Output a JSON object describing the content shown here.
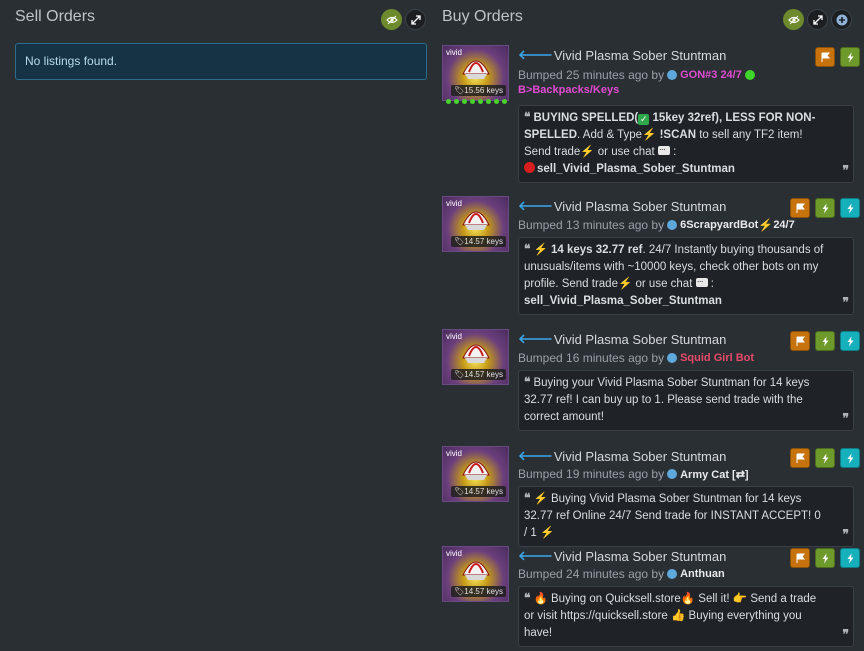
{
  "sell": {
    "title": "Sell Orders",
    "empty": "No listings found."
  },
  "buy": {
    "title": "Buy Orders"
  },
  "icons": {
    "visibility": "eye-icon",
    "expand": "expand-icon",
    "add": "plus-icon",
    "flag": "flag-icon",
    "bolt": "lightning-icon"
  },
  "colors": {
    "accent_green": "#6d8a2c",
    "flag_orange": "#c6730e",
    "bolt_green": "#6d9a2a",
    "bolt_teal": "#16b0bc",
    "info_blue": "#153344"
  },
  "listings": [
    {
      "quality": "vivid",
      "price": "15.56 keys",
      "name": "Vivid Plasma Sober Stuntman",
      "bumped": "Bumped 25 minutes ago by",
      "user": "GON#3 24/7",
      "user_color": "#e04bd0",
      "category": "B>Backpacks/Keys",
      "msg": {
        "p1": "BUYING SPELLED(",
        "p2": " 15key 32ref), LESS FOR NON-SPELLED",
        "p3": ". Add & Type",
        "p4": " !SCAN",
        "p5": " to sell any TF2 item! Send trade",
        "p6": " or  use  chat",
        "p7": " :",
        "p8": "sell_Vivid_Plasma_Sober_Stuntman"
      }
    },
    {
      "quality": "vivid",
      "price": "14.57 keys",
      "name": "Vivid Plasma Sober Stuntman",
      "bumped": "Bumped 13 minutes ago by",
      "user": "6ScrapyardBot",
      "user_suffix": " 24/7",
      "user_color": "#e8eaec",
      "msg": {
        "p1": " 14 keys 32.77 ref",
        "p2": ". 24/7 Instantly buying thousands of unusuals/items with ~10000 keys, check other bots on my profile. Send  trade",
        "p3": " or  use  chat",
        "p4": " :",
        "p5": "sell_Vivid_Plasma_Sober_Stuntman"
      }
    },
    {
      "quality": "vivid",
      "price": "14.57 keys",
      "name": "Vivid Plasma Sober Stuntman",
      "bumped": "Bumped 16 minutes ago by",
      "user": "Squid Girl Bot",
      "user_color": "#e84a6a",
      "msg": "Buying your Vivid Plasma Sober Stuntman for 14 keys 32.77 ref! I can buy up to 1. Please send trade with the correct amount!"
    },
    {
      "quality": "vivid",
      "price": "14.57 keys",
      "name": "Vivid Plasma Sober Stuntman",
      "bumped": "Bumped 19 minutes ago by",
      "user": "Army Cat [⇄]",
      "user_color": "#e8eaec",
      "msg": {
        "p1": " Buying Vivid Plasma Sober Stuntman for 14 keys 32.77 ref Online 24/7 Send trade for INSTANT ACCEPT! 0 / 1 "
      }
    },
    {
      "quality": "vivid",
      "price": "14.57 keys",
      "name": "Vivid Plasma Sober Stuntman",
      "bumped": "Bumped 24 minutes ago by",
      "user": "Anthuan",
      "user_color": "#e8eaec",
      "msg": {
        "p1": " Buying on Quicksell.store",
        "p2": " Sell it! ",
        "p3": " Send a trade or visit https://quicksell.store ",
        "p4": " Buying everything you have!"
      }
    }
  ]
}
